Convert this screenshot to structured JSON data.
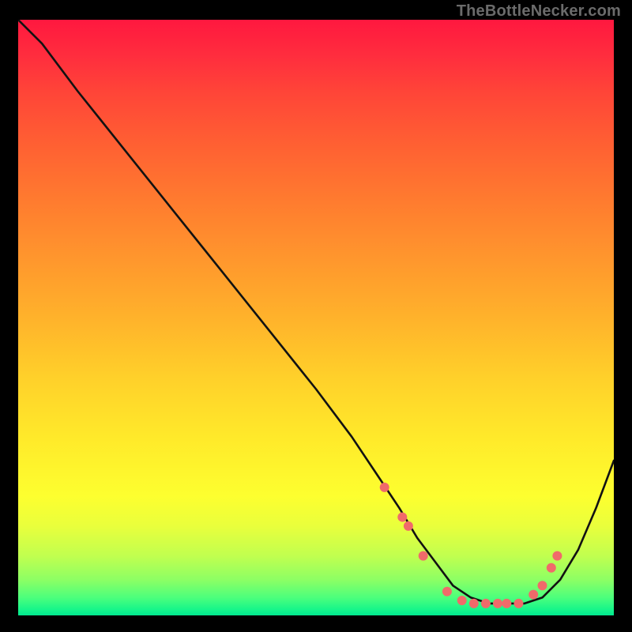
{
  "watermark": "TheBottleNecker.com",
  "colors": {
    "background": "#000000",
    "curve_stroke": "#121212",
    "dot_fill": "#f06a6a",
    "gradient_top": "#ff183f",
    "gradient_bottom": "#00e88f"
  },
  "chart_data": {
    "type": "line",
    "title": "",
    "xlabel": "",
    "ylabel": "",
    "xlim": [
      0,
      100
    ],
    "ylim": [
      0,
      100
    ],
    "series": [
      {
        "name": "bottleneck-curve",
        "x": [
          0,
          4,
          10,
          18,
          26,
          34,
          42,
          50,
          56,
          60,
          64,
          67,
          70,
          73,
          76,
          79,
          82,
          85,
          88,
          91,
          94,
          97,
          100
        ],
        "y": [
          100,
          96,
          88,
          78,
          68,
          58,
          48,
          38,
          30,
          24,
          18,
          13,
          9,
          5,
          3,
          2,
          2,
          2,
          3,
          6,
          11,
          18,
          26
        ]
      }
    ],
    "markers": {
      "name": "highlight-points",
      "x": [
        61.5,
        64.5,
        65.5,
        68.0,
        72.0,
        74.5,
        76.5,
        78.5,
        80.5,
        82.0,
        84.0,
        86.5,
        88.0,
        89.5,
        90.5
      ],
      "y": [
        21.5,
        16.5,
        15.0,
        10.0,
        4.0,
        2.5,
        2.0,
        2.0,
        2.0,
        2.0,
        2.0,
        3.5,
        5.0,
        8.0,
        10.0
      ]
    }
  }
}
